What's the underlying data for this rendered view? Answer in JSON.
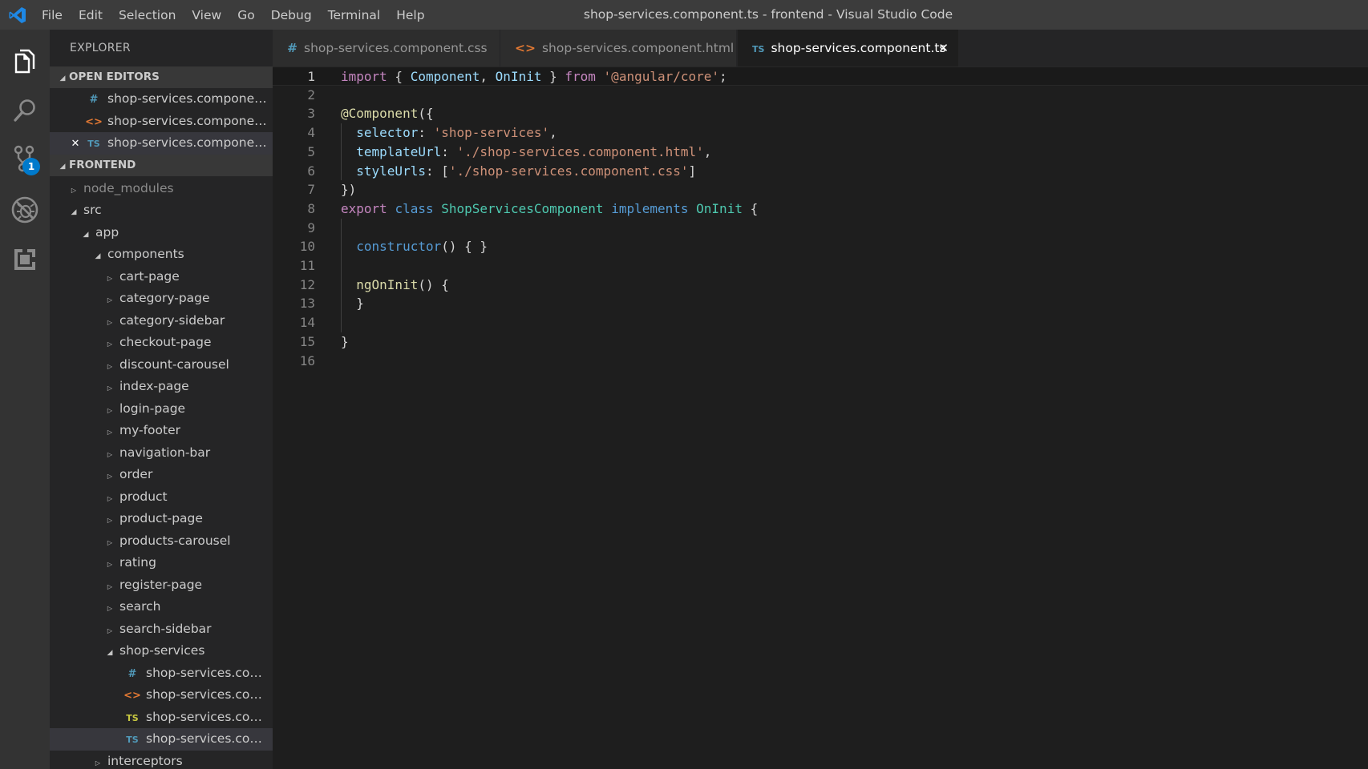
{
  "window": {
    "title": "shop-services.component.ts - frontend - Visual Studio Code",
    "menu": [
      "File",
      "Edit",
      "Selection",
      "View",
      "Go",
      "Debug",
      "Terminal",
      "Help"
    ]
  },
  "activity_bar": {
    "items": [
      {
        "name": "explorer-icon",
        "active": true
      },
      {
        "name": "search-icon"
      },
      {
        "name": "source-control-icon",
        "badge": "1"
      },
      {
        "name": "debug-icon"
      },
      {
        "name": "extensions-icon"
      }
    ]
  },
  "sidebar": {
    "title": "EXPLORER",
    "open_editors_label": "OPEN EDITORS",
    "open_editors": [
      {
        "icon": "#",
        "type": "css",
        "label": "shop-services.component.css"
      },
      {
        "icon": "<>",
        "type": "html",
        "label": "shop-services.component.html"
      },
      {
        "icon": "TS",
        "type": "ts",
        "label": "shop-services.component.ts",
        "active": true,
        "close": "×"
      }
    ],
    "project_label": "FRONTEND",
    "tree": [
      {
        "label": "node_modules",
        "depth": 0,
        "state": "collapsed",
        "dim": true
      },
      {
        "label": "src",
        "depth": 0,
        "state": "expanded"
      },
      {
        "label": "app",
        "depth": 1,
        "state": "expanded"
      },
      {
        "label": "components",
        "depth": 2,
        "state": "expanded"
      },
      {
        "label": "cart-page",
        "depth": 3,
        "state": "collapsed"
      },
      {
        "label": "category-page",
        "depth": 3,
        "state": "collapsed"
      },
      {
        "label": "category-sidebar",
        "depth": 3,
        "state": "collapsed"
      },
      {
        "label": "checkout-page",
        "depth": 3,
        "state": "collapsed"
      },
      {
        "label": "discount-carousel",
        "depth": 3,
        "state": "collapsed"
      },
      {
        "label": "index-page",
        "depth": 3,
        "state": "collapsed"
      },
      {
        "label": "login-page",
        "depth": 3,
        "state": "collapsed"
      },
      {
        "label": "my-footer",
        "depth": 3,
        "state": "collapsed"
      },
      {
        "label": "navigation-bar",
        "depth": 3,
        "state": "collapsed"
      },
      {
        "label": "order",
        "depth": 3,
        "state": "collapsed"
      },
      {
        "label": "product",
        "depth": 3,
        "state": "collapsed"
      },
      {
        "label": "product-page",
        "depth": 3,
        "state": "collapsed"
      },
      {
        "label": "products-carousel",
        "depth": 3,
        "state": "collapsed"
      },
      {
        "label": "rating",
        "depth": 3,
        "state": "collapsed"
      },
      {
        "label": "register-page",
        "depth": 3,
        "state": "collapsed"
      },
      {
        "label": "search",
        "depth": 3,
        "state": "collapsed"
      },
      {
        "label": "search-sidebar",
        "depth": 3,
        "state": "collapsed"
      },
      {
        "label": "shop-services",
        "depth": 3,
        "state": "expanded"
      },
      {
        "label": "shop-services.compon...",
        "depth": 4,
        "state": "file",
        "icon": "#",
        "type": "css"
      },
      {
        "label": "shop-services.compon...",
        "depth": 4,
        "state": "file",
        "icon": "<>",
        "type": "html"
      },
      {
        "label": "shop-services.compon...",
        "depth": 4,
        "state": "file",
        "icon": "TS",
        "type": "ts-spec"
      },
      {
        "label": "shop-services.compon...",
        "depth": 4,
        "state": "file",
        "icon": "TS",
        "type": "ts",
        "selected": true
      },
      {
        "label": "interceptors",
        "depth": 2,
        "state": "collapsed"
      }
    ]
  },
  "tabs": [
    {
      "icon": "#",
      "type": "css",
      "label": "shop-services.component.css"
    },
    {
      "icon": "<>",
      "type": "html",
      "label": "shop-services.component.html"
    },
    {
      "icon": "TS",
      "type": "ts",
      "label": "shop-services.component.ts",
      "active": true,
      "close": "×"
    }
  ],
  "editor": {
    "current_line": 1,
    "lines": [
      [
        [
          "kw",
          "import"
        ],
        [
          "pu",
          " { "
        ],
        [
          "vr",
          "Component"
        ],
        [
          "pu",
          ", "
        ],
        [
          "vr",
          "OnInit"
        ],
        [
          "pu",
          " } "
        ],
        [
          "kw",
          "from"
        ],
        [
          "pu",
          " "
        ],
        [
          "st",
          "'@angular/core'"
        ],
        [
          "pu",
          ";"
        ]
      ],
      [],
      [
        [
          "dc",
          "@Component"
        ],
        [
          "pu",
          "({"
        ]
      ],
      [
        [
          "pu",
          "  "
        ],
        [
          "vr",
          "selector"
        ],
        [
          "pu",
          ": "
        ],
        [
          "st",
          "'shop-services'"
        ],
        [
          "pu",
          ","
        ]
      ],
      [
        [
          "pu",
          "  "
        ],
        [
          "vr",
          "templateUrl"
        ],
        [
          "pu",
          ": "
        ],
        [
          "st",
          "'./shop-services.component.html'"
        ],
        [
          "pu",
          ","
        ]
      ],
      [
        [
          "pu",
          "  "
        ],
        [
          "vr",
          "styleUrls"
        ],
        [
          "pu",
          ": ["
        ],
        [
          "st",
          "'./shop-services.component.css'"
        ],
        [
          "pu",
          "]"
        ]
      ],
      [
        [
          "pu",
          "})"
        ]
      ],
      [
        [
          "kw",
          "export"
        ],
        [
          "pu",
          " "
        ],
        [
          "kb",
          "class"
        ],
        [
          "pu",
          " "
        ],
        [
          "ty",
          "ShopServicesComponent"
        ],
        [
          "pu",
          " "
        ],
        [
          "kb",
          "implements"
        ],
        [
          "pu",
          " "
        ],
        [
          "ty",
          "OnInit"
        ],
        [
          "pu",
          " {"
        ]
      ],
      [],
      [
        [
          "pu",
          "  "
        ],
        [
          "kb",
          "constructor"
        ],
        [
          "pu",
          "() { }"
        ]
      ],
      [],
      [
        [
          "pu",
          "  "
        ],
        [
          "fn",
          "ngOnInit"
        ],
        [
          "pu",
          "() {"
        ]
      ],
      [
        [
          "pu",
          "  }"
        ]
      ],
      [],
      [
        [
          "pu",
          "}"
        ]
      ],
      []
    ]
  },
  "colors": {
    "accent": "#007acc",
    "css_icon": "#519aba",
    "html_icon": "#e37933",
    "ts_icon": "#519aba"
  }
}
